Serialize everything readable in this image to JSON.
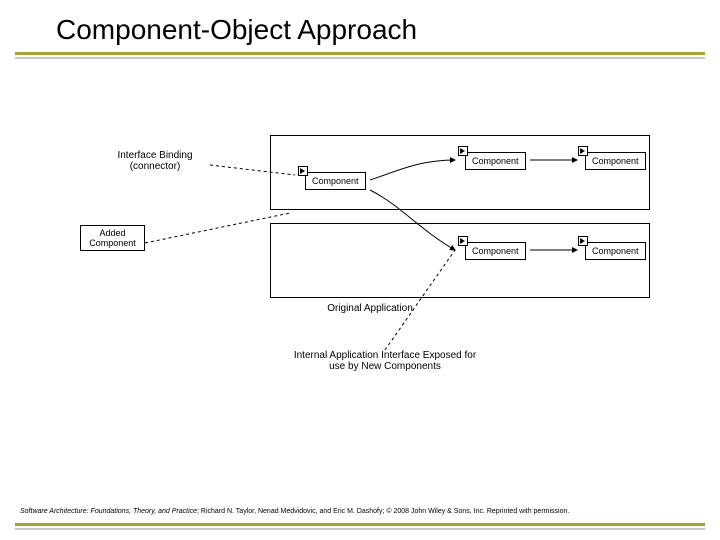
{
  "title": "Component-Object Approach",
  "footer": {
    "source": "Software Architecture: Foundations, Theory, and Practice",
    "rest": "; Richard N. Taylor, Nenad Medvidovic, and Eric M. Dashofy; © 2008 John Wiley & Sons, Inc. Reprinted with permission."
  },
  "diagram": {
    "component_label": "Component",
    "added_label": "Added Component",
    "interface_binding_l1": "Interface Binding",
    "interface_binding_l2": "(connector)",
    "original_app": "Original Application",
    "exposed_l1": "Internal Application Interface Exposed for",
    "exposed_l2": "use by New Components"
  }
}
